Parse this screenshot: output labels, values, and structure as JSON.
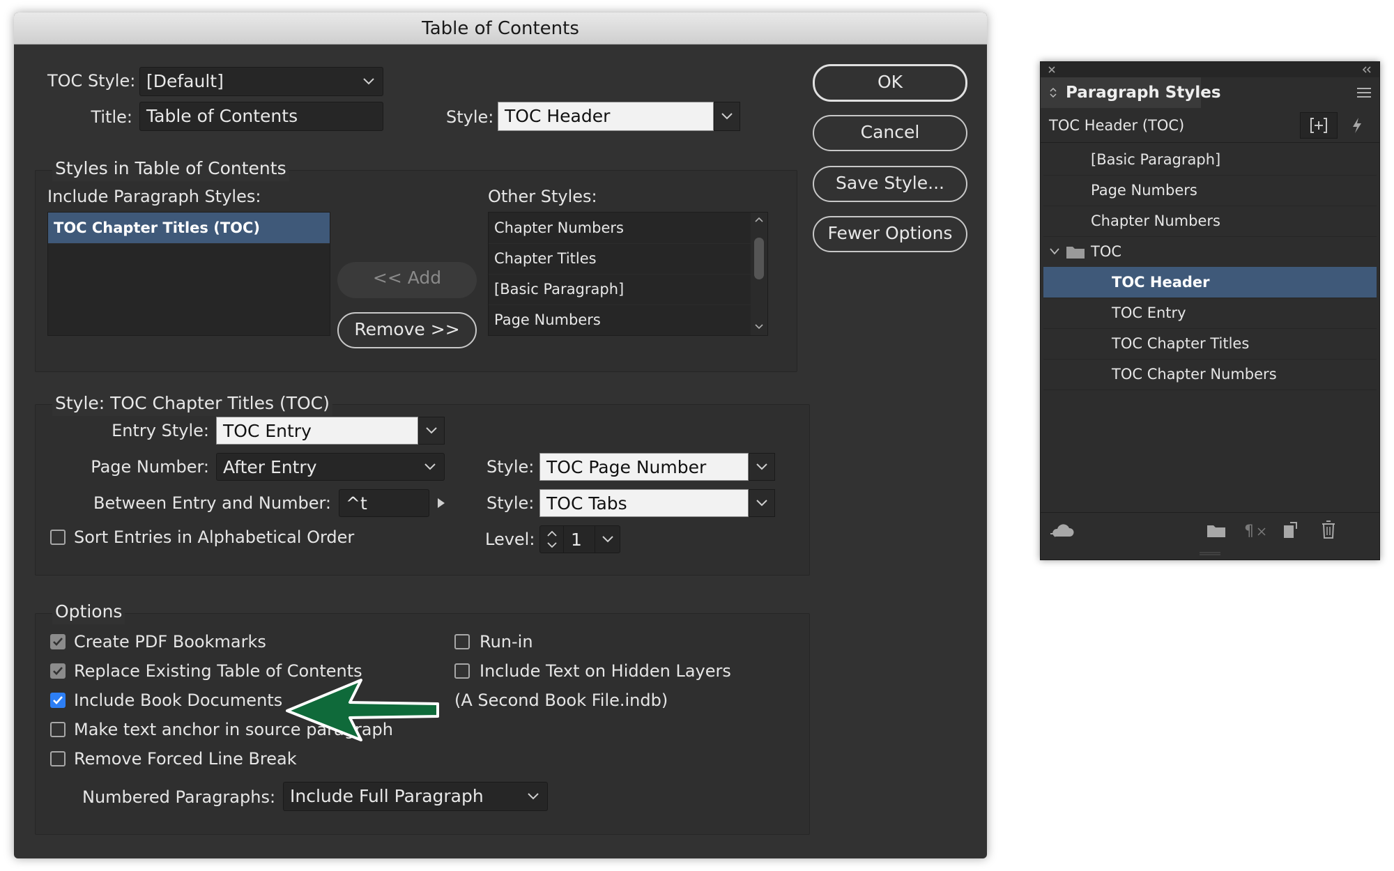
{
  "dialog": {
    "title": "Table of Contents",
    "toc_style_label": "TOC Style:",
    "toc_style_value": "[Default]",
    "title_label": "Title:",
    "title_value": "Table of Contents",
    "title_style_label": "Style:",
    "title_style_value": "TOC Header",
    "buttons": {
      "ok": "OK",
      "cancel": "Cancel",
      "save_style": "Save Style...",
      "fewer_options": "Fewer Options"
    },
    "styles_group": {
      "title": "Styles in Table of Contents",
      "include_label": "Include Paragraph Styles:",
      "include_items": [
        "TOC Chapter Titles (TOC)"
      ],
      "add_label": "<< Add",
      "remove_label": "Remove >>",
      "other_label": "Other Styles:",
      "other_items": [
        "Chapter Numbers",
        "Chapter Titles",
        "[Basic Paragraph]",
        "Page Numbers"
      ]
    },
    "style_group": {
      "title": "Style: TOC Chapter Titles (TOC)",
      "entry_style_label": "Entry Style:",
      "entry_style_value": "TOC Entry",
      "page_number_label": "Page Number:",
      "page_number_value": "After Entry",
      "page_number_style_label": "Style:",
      "page_number_style_value": "TOC Page Number",
      "between_label": "Between Entry and Number:",
      "between_value": "^t",
      "between_style_label": "Style:",
      "between_style_value": "TOC Tabs",
      "sort_label": "Sort Entries in Alphabetical Order",
      "sort_checked": false,
      "level_label": "Level:",
      "level_value": "1"
    },
    "options_group": {
      "title": "Options",
      "create_pdf": "Create PDF Bookmarks",
      "replace_existing": "Replace Existing Table of Contents",
      "include_book": "Include Book Documents",
      "book_file": "(A Second Book File.indb)",
      "make_anchor": "Make text anchor in source paragraph",
      "remove_forced": "Remove Forced Line Break",
      "run_in": "Run-in",
      "include_hidden": "Include Text on Hidden Layers",
      "numbered_label": "Numbered Paragraphs:",
      "numbered_value": "Include Full Paragraph"
    }
  },
  "panel": {
    "title": "Paragraph Styles",
    "current_style": "TOC Header (TOC)",
    "items": [
      "[Basic Paragraph]",
      "Page Numbers",
      "Chapter Numbers"
    ],
    "group_name": "TOC",
    "group_items": [
      "TOC Header",
      "TOC Entry",
      "TOC Chapter Titles",
      "TOC Chapter Numbers"
    ]
  },
  "colors": {
    "dialog_bg": "#323232",
    "selection": "#3f5979",
    "checkbox_blue": "#2d7ff5",
    "arrow_green": "#0f6a3a"
  }
}
